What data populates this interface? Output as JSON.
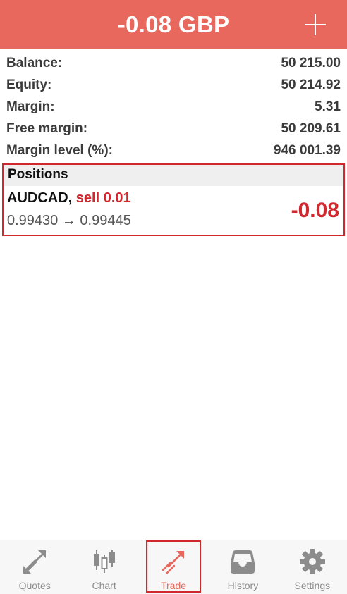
{
  "header": {
    "title": "-0.08 GBP"
  },
  "summary": [
    {
      "label": "Balance:",
      "value": "50 215.00"
    },
    {
      "label": "Equity:",
      "value": "50 214.92"
    },
    {
      "label": "Margin:",
      "value": "5.31"
    },
    {
      "label": "Free margin:",
      "value": "50 209.61"
    },
    {
      "label": "Margin level (%):",
      "value": "946 001.39"
    }
  ],
  "positions": {
    "heading": "Positions",
    "items": [
      {
        "symbol": "AUDCAD,",
        "side": "sell 0.01",
        "prices": "0.99430 → 0.99445",
        "profit": "-0.08"
      }
    ]
  },
  "tabs": [
    {
      "label": "Quotes"
    },
    {
      "label": "Chart"
    },
    {
      "label": "Trade"
    },
    {
      "label": "History"
    },
    {
      "label": "Settings"
    }
  ],
  "colors": {
    "accent": "#e8685e",
    "loss": "#d0282e",
    "icon": "#888888"
  }
}
